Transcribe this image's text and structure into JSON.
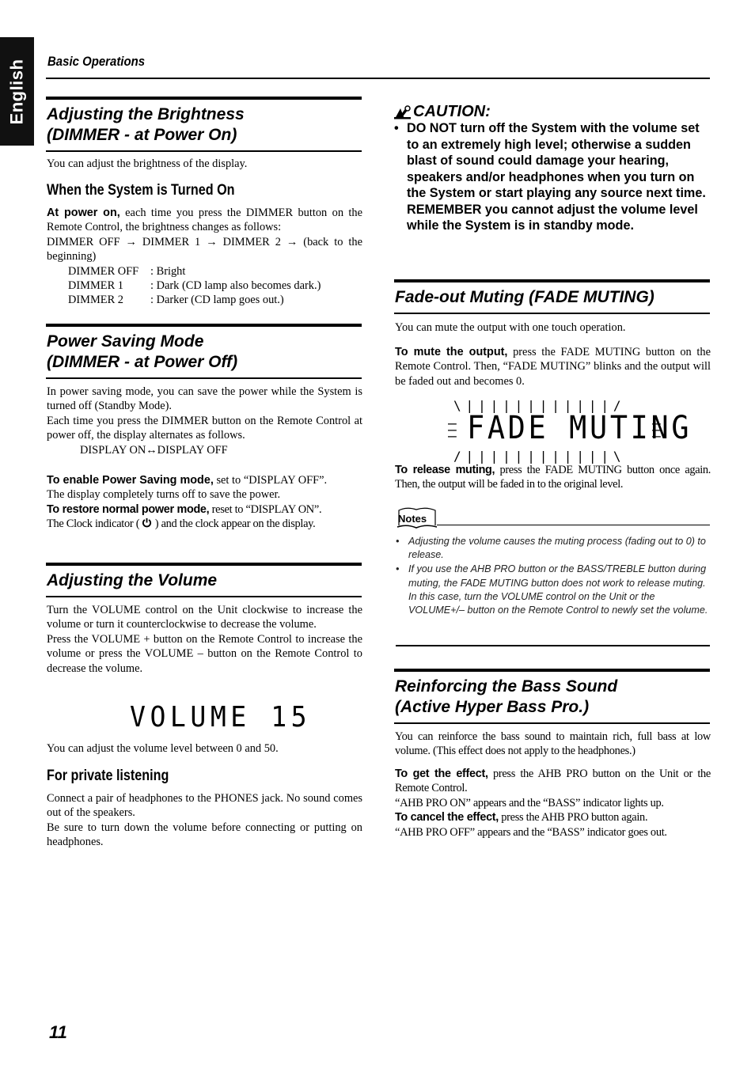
{
  "language_tab": "English",
  "running_head": "Basic Operations",
  "page_number": "11",
  "left": {
    "brightness": {
      "title_l1": "Adjusting the Brightness",
      "title_l2": "(DIMMER - at Power On)",
      "intro": "You can adjust the brightness of the display.",
      "subhead": "When the System is Turned On",
      "lead_bold": "At power on,",
      "lead_text": " each time you press the DIMMER button on the Remote Control, the brightness changes as follows:",
      "sequence": "DIMMER OFF → DIMMER 1 → DIMMER 2 → (back to the beginning)",
      "levels": [
        {
          "name": "DIMMER OFF",
          "desc": ": Bright"
        },
        {
          "name": "DIMMER 1",
          "desc": ": Dark (CD lamp also becomes dark.)"
        },
        {
          "name": "DIMMER 2",
          "desc": ": Darker (CD lamp goes out.)"
        }
      ]
    },
    "power_saving": {
      "title_l1": "Power Saving Mode",
      "title_l2": "(DIMMER - at Power Off)",
      "p1": "In power saving mode, you can save the power while the System is turned off (Standby Mode).",
      "p2": "Each time you press the DIMMER button on the Remote Control at power off, the display alternates as follows.",
      "toggle": "DISPLAY ON↔DISPLAY OFF",
      "enable_bold": "To enable Power Saving mode,",
      "enable_text": " set to “DISPLAY OFF”.",
      "enable_note": "The display completely turns off to save the power.",
      "restore_bold": "To restore normal power mode,",
      "restore_text": " reset to “DISPLAY ON”.",
      "clock_pre": "The Clock indicator ( ",
      "clock_icon": "power-clock-icon",
      "clock_post": " ) and the clock appear on the display."
    },
    "volume": {
      "title": "Adjusting the Volume",
      "p1": "Turn the VOLUME control on the Unit clockwise to increase the volume or turn it counterclockwise to decrease the volume.",
      "p2": "Press the VOLUME + button on the Remote Control to increase the volume or press the VOLUME – button on the Remote Control to decrease the volume.",
      "display": "VOLUME 15",
      "range_note": "You can adjust the volume level between 0 and 50.",
      "subhead": "For private listening",
      "p3": "Connect a pair of headphones to the PHONES jack. No sound comes out of the speakers.",
      "p4": "Be sure to turn down the volume before connecting or putting on headphones."
    }
  },
  "right": {
    "caution": {
      "icon": "caution-pen-icon",
      "title": "CAUTION:",
      "bullet": "DO NOT turn off the System with the volume set to an extremely high level; otherwise a sudden blast of sound could damage your hearing, speakers and/or headphones when you turn on the System or start playing any source next time.",
      "remember": "REMEMBER you cannot adjust the volume level while the System is in standby mode."
    },
    "fade": {
      "title": "Fade-out Muting (FADE MUTING)",
      "intro": "You can mute the output with one touch operation.",
      "mute_bold": "To mute the output,",
      "mute_text": " press the FADE MUTING button on the Remote Control. Then, “FADE MUTING” blinks and the output will be faded out and becomes 0.",
      "display": "FADE MUTING",
      "release_bold": "To release muting,",
      "release_text": " press the FADE MUTING button once again. Then, the output will be faded in to the original level."
    },
    "notes": {
      "label": "Notes",
      "items": [
        "Adjusting the volume causes the muting process (fading out to 0) to release.",
        "If you use the AHB PRO button or the BASS/TREBLE button during muting, the FADE MUTING button does not work to release muting. In this case, turn the VOLUME control on the Unit or the VOLUME+/– button on the Remote Control to newly set the volume."
      ]
    },
    "bass": {
      "title_l1": "Reinforcing the Bass Sound",
      "title_l2": "(Active Hyper Bass Pro.)",
      "intro": "You can reinforce the bass sound to maintain rich, full bass at low volume. (This effect does not apply to the headphones.)",
      "get_bold": "To get the effect,",
      "get_text": " press the AHB PRO button on the Unit or the Remote Control.",
      "on_note": "“AHB PRO ON” appears and the “BASS” indicator lights up.",
      "cancel_bold": "To cancel the effect,",
      "cancel_text": " press the AHB PRO button again.",
      "off_note": "“AHB PRO OFF” appears and the “BASS” indicator goes out."
    }
  }
}
